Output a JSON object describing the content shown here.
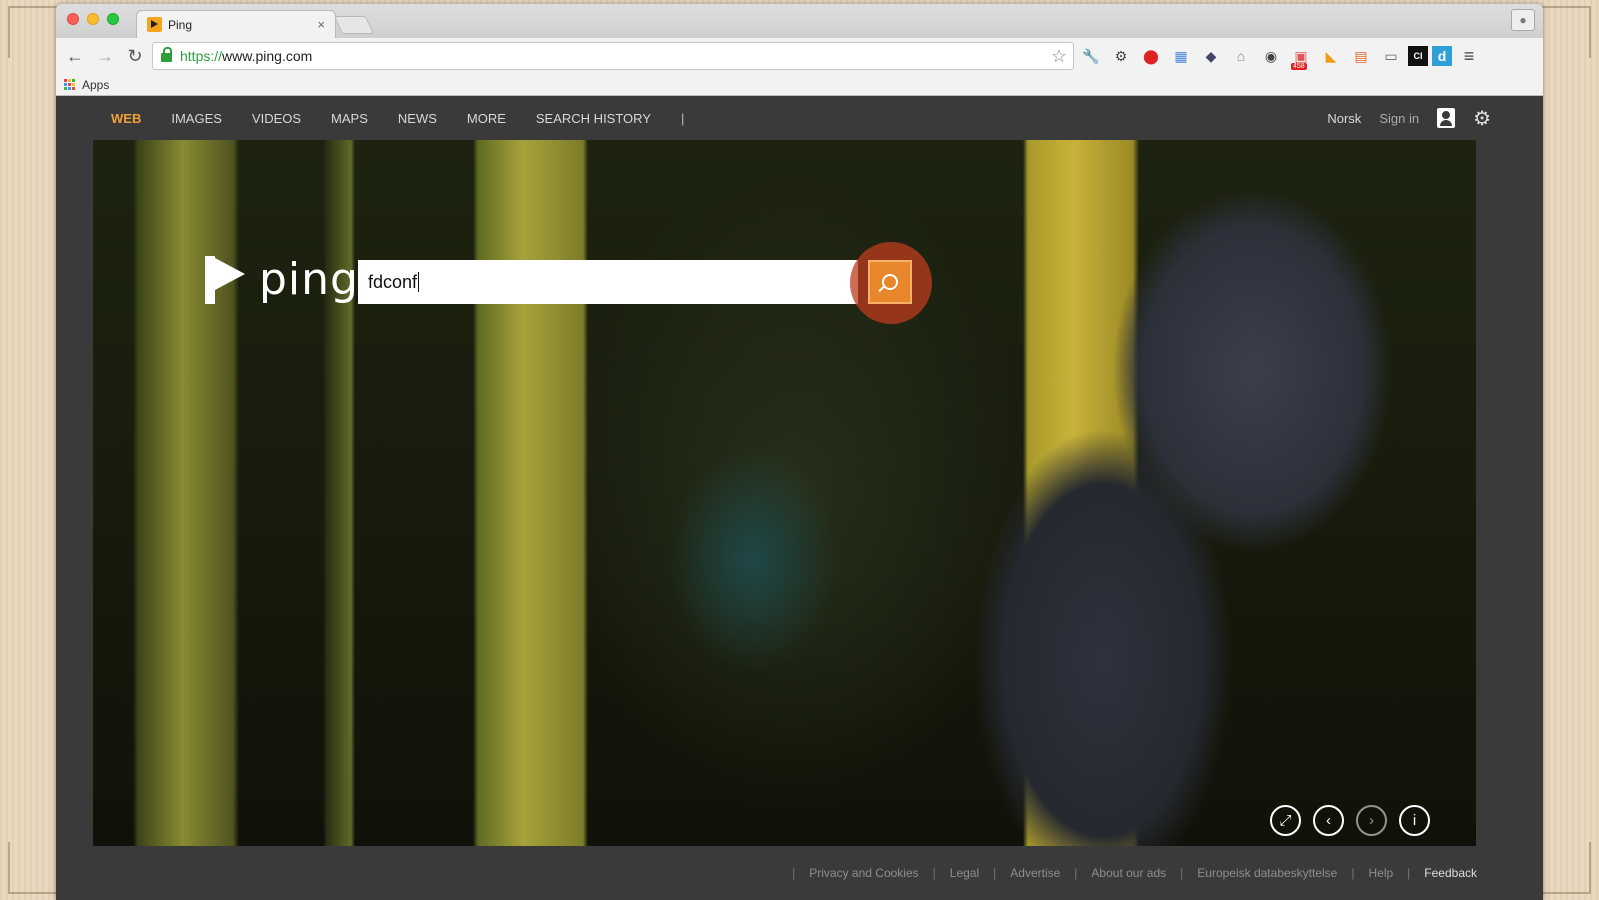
{
  "browser": {
    "tab_title": "Ping",
    "url_scheme": "https://",
    "url_rest": "www.ping.com",
    "bookmarks_apps": "Apps",
    "ext_badge": "458",
    "ext_ci": "CI",
    "ext_d": "d"
  },
  "nav": {
    "links": [
      "WEB",
      "IMAGES",
      "VIDEOS",
      "MAPS",
      "NEWS",
      "MORE",
      "SEARCH HISTORY"
    ],
    "separator": "|",
    "language": "Norsk",
    "sign_in": "Sign in"
  },
  "logo": {
    "text": "ping"
  },
  "search": {
    "value": "fdconf"
  },
  "footer": {
    "links": [
      "Privacy and Cookies",
      "Legal",
      "Advertise",
      "About our ads",
      "Europeisk databeskyttelse",
      "Help",
      "Feedback"
    ],
    "separator": "|"
  },
  "colors": {
    "accent": "#f2a234",
    "search_button": "#e8862b",
    "nav_bg": "#3a3a3a"
  }
}
